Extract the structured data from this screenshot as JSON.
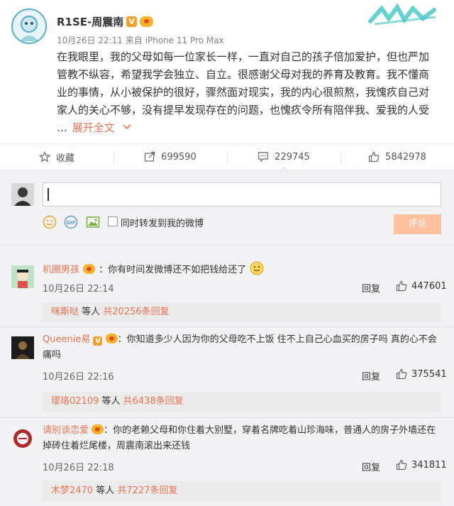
{
  "post": {
    "author": "R1SE-周震南",
    "time": "10月26日 22:11",
    "source": "来自 iPhone 11 Pro Max",
    "lines": [
      "在我眼里，我的父母如每一位家长一样，一直对自己的孩子倍加爱护，但也严加",
      "管教不纵容，希望我学会独立、自立。很感谢父母对我的养育及教育。我不懂商",
      "业的事情，从小被保护的很好，骤然面对现实，我的内心很煎熬，我愧疚自己对",
      "家人的关心不够，没有提早发现存在的问题，也愧疚令所有陪伴我、爱我的人受"
    ],
    "ellipsis": "…",
    "expand_label": "展开全文"
  },
  "actions": {
    "favorite": "收藏",
    "repost": "699590",
    "comment": "229745",
    "like": "5842978"
  },
  "composer": {
    "input_value": "",
    "repost_label": "同时转发到我的微博",
    "submit_label": "评论",
    "gif_label": "GIF"
  },
  "comments": [
    {
      "name": "机圈男孩",
      "text": "你有时间发微博还不如把钱给还了",
      "time": "10月26日 22:14",
      "reply_label": "回复",
      "likes": "447601",
      "sub_user": "咪斯哒",
      "sub_mid": " 等人 ",
      "sub_count": "共20256条回复"
    },
    {
      "name": "Queenie易",
      "text_line1": "你知道多少人因为你的父母吃不上饭 住不上自己心血买的房子吗 真的心不会",
      "text_line2": "痛吗",
      "time": "10月26日 22:16",
      "reply_label": "回复",
      "likes": "375541",
      "sub_user": "璎珞02109",
      "sub_mid": " 等人 ",
      "sub_count": "共6438条回复"
    },
    {
      "name": "请别谈恋爱",
      "text_line1": "你的老赖父母和你住着大别墅，穿着名牌吃着山珍海味，普通人的房子外墙还在",
      "text_line2": "掉砖住着烂尾楼，周震南滚出来还钱",
      "time": "10月26日 22:18",
      "reply_label": "回复",
      "likes": "341811",
      "sub_user": "木梦2470",
      "sub_mid": " 等人 ",
      "sub_count": "共7227条回复"
    }
  ],
  "colors": {
    "accent": "#eb7350",
    "panel": "#f2f2f5",
    "submit_disabled": "#ffc09f"
  }
}
